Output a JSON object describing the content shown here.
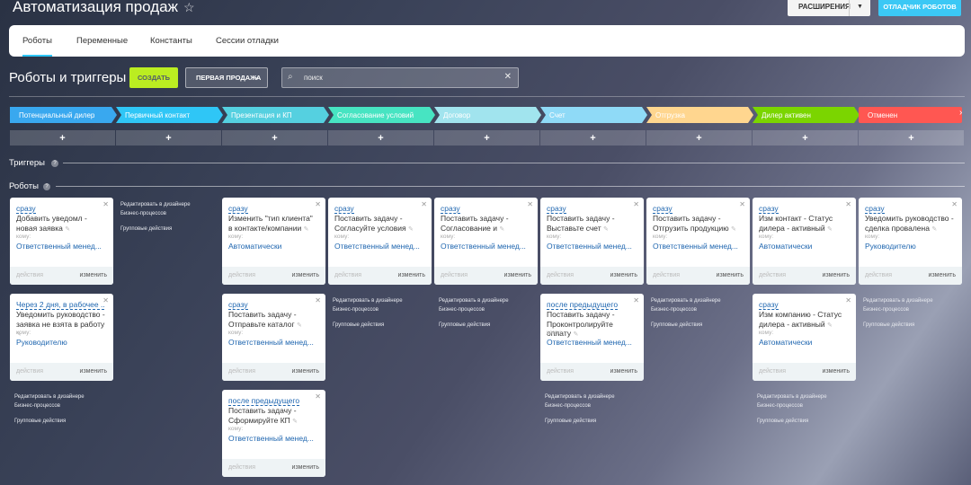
{
  "header": {
    "title": "Автоматизация продаж",
    "extensions_label": "РАСШИРЕНИЯ",
    "robots_store_label": "ОТЛАДЧИК РОБОТОВ"
  },
  "tabs": [
    "Роботы",
    "Переменные",
    "Константы",
    "Сессии отладки"
  ],
  "toolbar": {
    "section_title": "Роботы и триггеры",
    "create_label": "СОЗДАТЬ",
    "pipeline_label": "ПЕРВАЯ ПРОДАЖА",
    "search_placeholder": "поиск"
  },
  "stages": [
    {
      "name": "Потенциальный дилер",
      "color": "#39a8ef"
    },
    {
      "name": "Первичный контакт",
      "color": "#2fc6f6"
    },
    {
      "name": "Презентация и КП",
      "color": "#55d0e0"
    },
    {
      "name": "Согласование условий",
      "color": "#47e4c2"
    },
    {
      "name": "Договор",
      "color": "#a1e4ee"
    },
    {
      "name": "Счет",
      "color": "#8fdaf7"
    },
    {
      "name": "Отгрузка",
      "color": "#ffd68f"
    },
    {
      "name": "Дилер активен",
      "color": "#7bd500"
    },
    {
      "name": "Отменен",
      "color": "#ff5752"
    }
  ],
  "plus_label": "+",
  "triggers_title": "Триггеры",
  "robots_title": "Роботы",
  "card_common": {
    "to_label": "кому:",
    "actions_label": "действия",
    "edit_label": "изменить"
  },
  "links": {
    "edit_designer": "Редактировать в дизайнере",
    "bp": "Бизнес-процессов",
    "group_actions": "Групповые действия"
  },
  "cards": [
    {
      "trigger": "сразу",
      "name": "Добавить уведомл - новая заявка",
      "resp": "Ответственный менед..."
    },
    {
      "trigger": "Через 2 дня, в рабочее ...",
      "name": "Уведомить руководство - заявка не взята в работу",
      "resp": "Руководителю"
    },
    {
      "trigger": "сразу",
      "name": "Изменить \"тип клиента\" в контакте/компании",
      "resp": "Автоматически"
    },
    {
      "trigger": "сразу",
      "name": "Поставить задачу - Отправьте каталог",
      "resp": "Ответственный менед..."
    },
    {
      "trigger": "после предыдущего",
      "name": "Поставить задачу - Сформируйте КП",
      "resp": "Ответственный менед..."
    },
    {
      "trigger": "сразу",
      "name": "Поставить задачу - Согласуйте условия",
      "resp": "Ответственный менед..."
    },
    {
      "trigger": "сразу",
      "name": "Поставить задачу - Согласование и",
      "resp": "Ответственный менед..."
    },
    {
      "trigger": "сразу",
      "name": "Поставить задачу - Выставьте счет",
      "resp": "Ответственный менед..."
    },
    {
      "trigger": "после предыдущего",
      "name": "Поставить задачу - Проконтролируйте оплату",
      "resp": "Ответственный менед..."
    },
    {
      "trigger": "сразу",
      "name": "Поставить задачу - Отгрузить продукцию",
      "resp": "Ответственный менед..."
    },
    {
      "trigger": "сразу",
      "name": "Изм контакт - Статус дилера - активный",
      "resp": "Автоматически"
    },
    {
      "trigger": "сразу",
      "name": "Изм компанию - Статус дилера - активный",
      "resp": "Автоматически"
    },
    {
      "trigger": "сразу",
      "name": "Уведомить руководство - сделка провалена",
      "resp": "Руководителю"
    }
  ]
}
